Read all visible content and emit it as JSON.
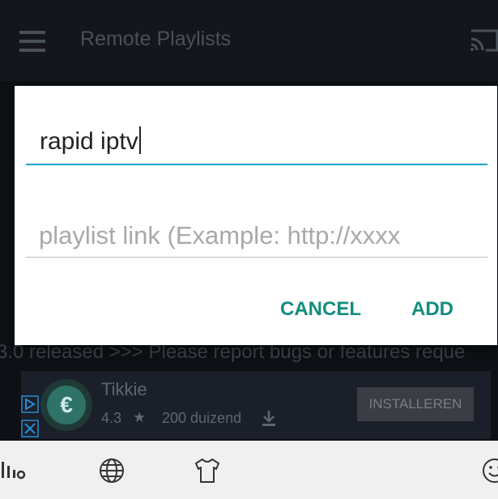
{
  "app_bar": {
    "title": "Remote Playlists",
    "menu_icon": "hamburger-menu-icon",
    "cast_icon": "cast-icon"
  },
  "dialog": {
    "name_value": "rapid iptv",
    "link_placeholder": "playlist link (Example: http://xxxx",
    "cancel_label": "CANCEL",
    "add_label": "ADD",
    "accent_color": "#138e80",
    "focus_color": "#1aa7c8"
  },
  "ticker": {
    "text": "3.0 released >>> Please report bugs or features reque"
  },
  "ad": {
    "app_name": "Tikkie",
    "rating": "4.3",
    "installs": "200 duizend",
    "install_label": "INSTALLEREN"
  },
  "keyboard": {
    "icons": [
      "voice-bars-icon",
      "globe-icon",
      "tshirt-icon",
      "emoji-icon"
    ]
  }
}
